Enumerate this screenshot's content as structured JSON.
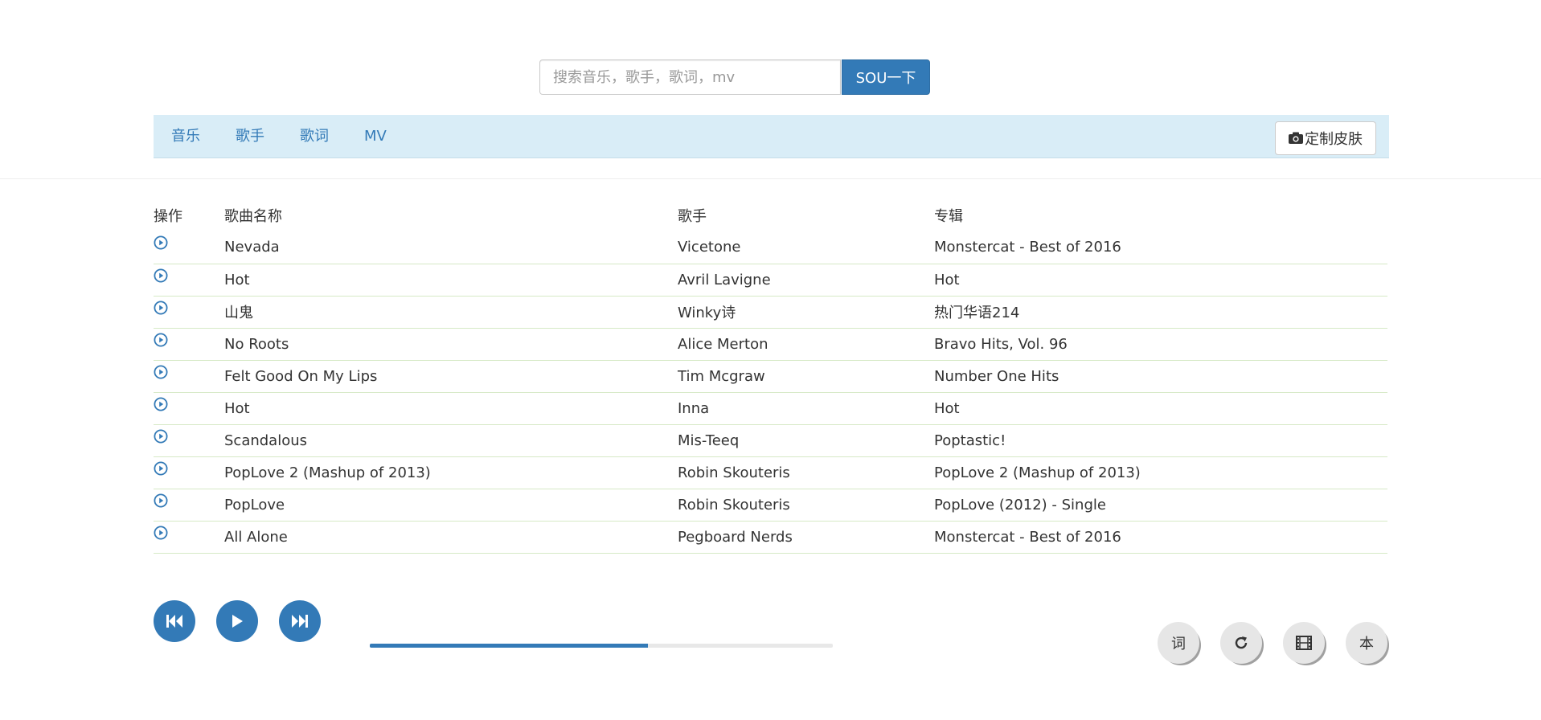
{
  "search": {
    "placeholder": "搜索音乐，歌手，歌词，mv",
    "value": "",
    "button_label": "SOU一下"
  },
  "nav": {
    "items": [
      {
        "label": "音乐"
      },
      {
        "label": "歌手"
      },
      {
        "label": "歌词"
      },
      {
        "label": "MV"
      }
    ],
    "skin_button_label": "定制皮肤",
    "skin_button_icon": "camera-icon"
  },
  "table": {
    "headers": {
      "op": "操作",
      "name": "歌曲名称",
      "artist": "歌手",
      "album": "专辑"
    },
    "play_icon": "play-circle-icon",
    "rows": [
      {
        "name": "Nevada",
        "artist": "Vicetone",
        "album": "Monstercat - Best of 2016"
      },
      {
        "name": "Hot",
        "artist": "Avril Lavigne",
        "album": "Hot"
      },
      {
        "name": "山鬼",
        "artist": "Winky诗",
        "album": "热门华语214"
      },
      {
        "name": "No Roots",
        "artist": "Alice Merton",
        "album": "Bravo Hits, Vol. 96"
      },
      {
        "name": "Felt Good On My Lips",
        "artist": "Tim Mcgraw",
        "album": "Number One Hits"
      },
      {
        "name": "Hot",
        "artist": "Inna",
        "album": "Hot"
      },
      {
        "name": "Scandalous",
        "artist": "Mis-Teeq",
        "album": "Poptastic!"
      },
      {
        "name": "PopLove 2 (Mashup of 2013)",
        "artist": "Robin Skouteris",
        "album": "PopLove 2 (Mashup of 2013)"
      },
      {
        "name": "PopLove",
        "artist": "Robin Skouteris",
        "album": "PopLove (2012) - Single"
      },
      {
        "name": "All Alone",
        "artist": "Pegboard Nerds",
        "album": "Monstercat - Best of 2016"
      }
    ]
  },
  "player": {
    "controls": [
      "previous-icon",
      "play-icon",
      "next-icon"
    ],
    "progress_fraction": 0.6
  },
  "side_buttons": {
    "lyrics_label": "词",
    "refresh_icon": "refresh-icon",
    "mv_icon": "film-icon",
    "local_label": "本"
  },
  "colors": {
    "primary": "#337ab7",
    "nav_background": "#d9edf7",
    "row_border": "#d6e9c6"
  }
}
